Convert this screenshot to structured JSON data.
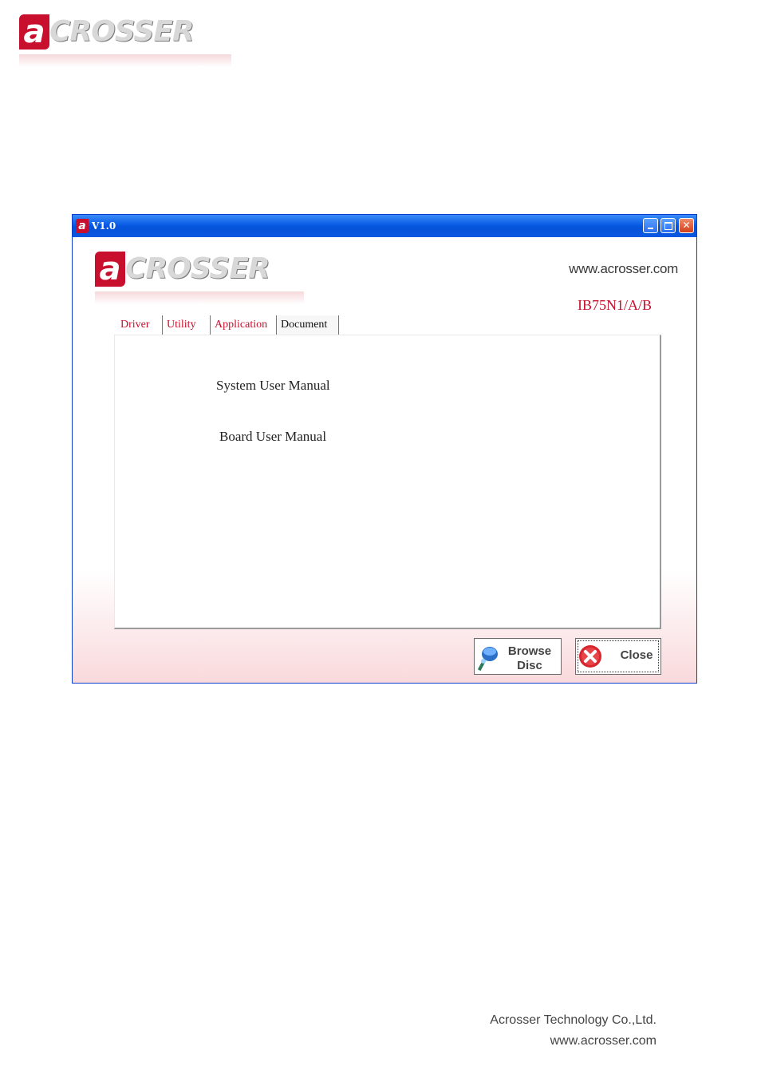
{
  "page_logo": {
    "mark": "a",
    "word": "CROSSER"
  },
  "window": {
    "title": "V1.0",
    "controls": {
      "minimize": "",
      "maximize": "",
      "close": "✕"
    },
    "logo": {
      "mark": "a",
      "word": "CROSSER"
    },
    "url": "www.acrosser.com",
    "model": "IB75N1/A/B",
    "tabs": [
      {
        "label": "Driver",
        "active": false
      },
      {
        "label": "Utility",
        "active": false
      },
      {
        "label": "Application",
        "active": false
      },
      {
        "label": "Document",
        "active": true
      }
    ],
    "documents": [
      "System User Manual",
      "Board User Manual"
    ],
    "buttons": {
      "browse_line1": "Browse",
      "browse_line2": "Disc",
      "close": "Close"
    }
  },
  "footer": {
    "company": "Acrosser Technology Co.,Ltd.",
    "url": "www.acrosser.com"
  },
  "colors": {
    "brand_red": "#c8102e",
    "titlebar_blue": "#0a5ce6"
  }
}
